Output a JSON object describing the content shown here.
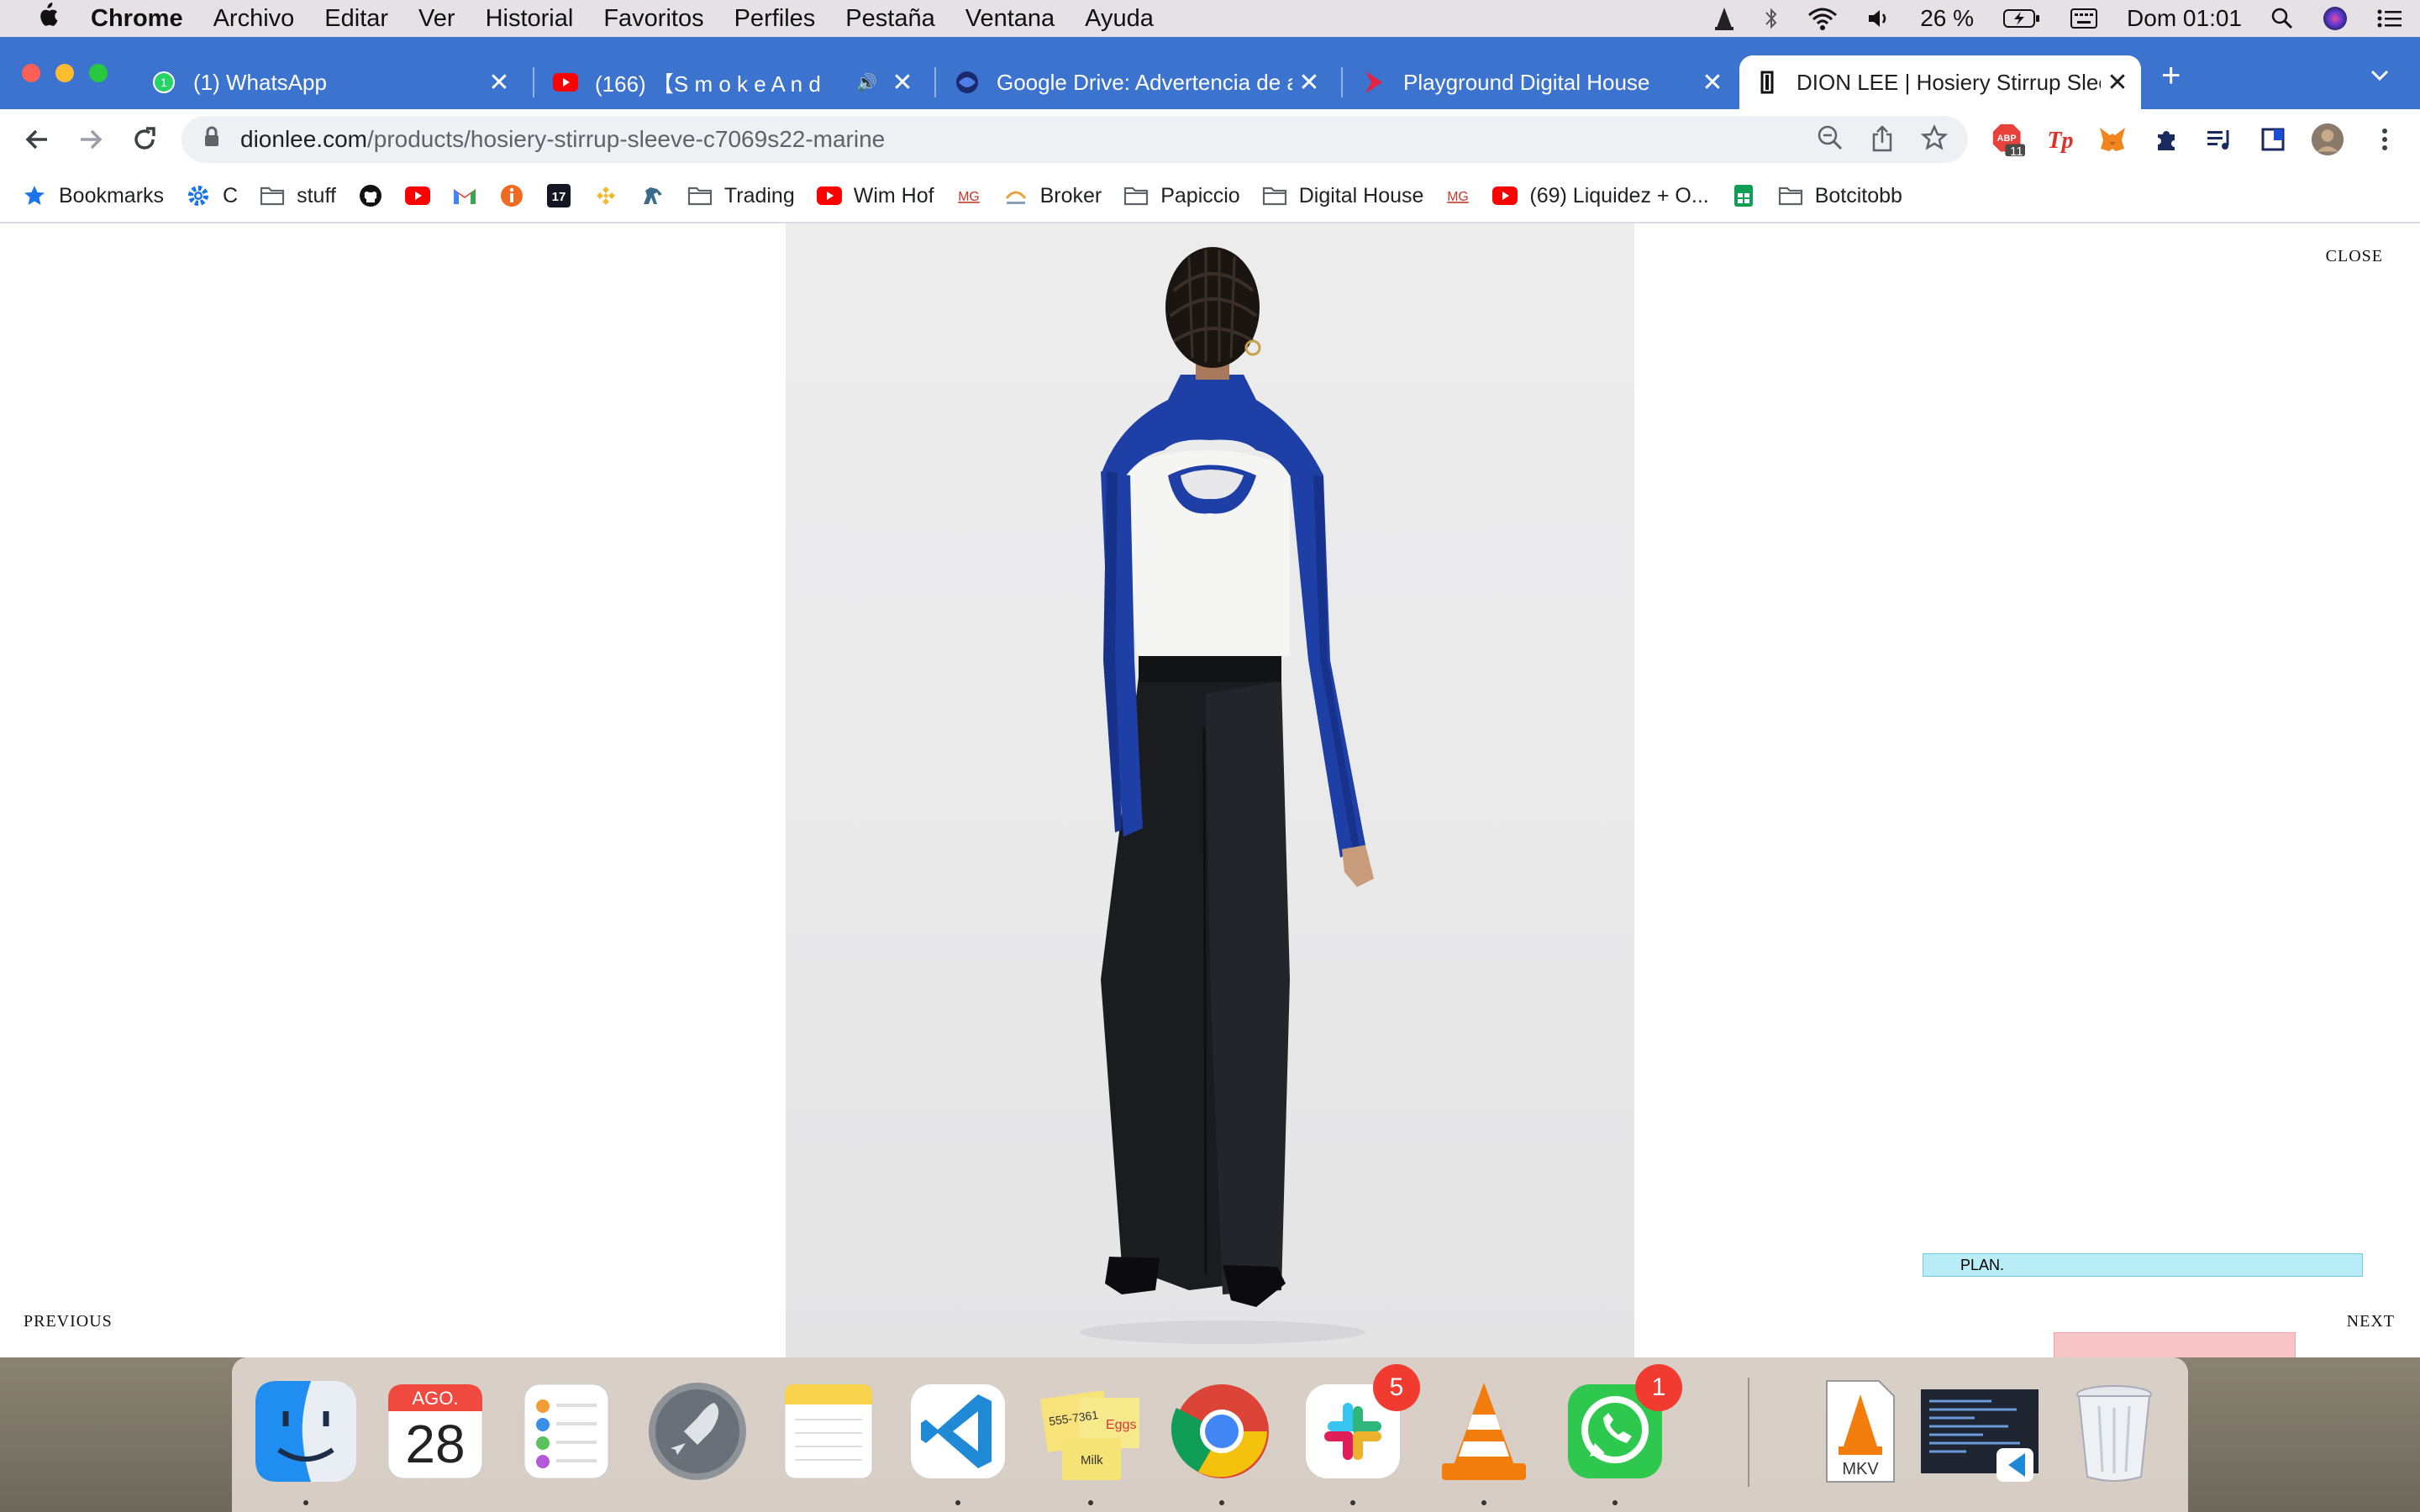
{
  "menubar": {
    "app": "Chrome",
    "items": [
      "Archivo",
      "Editar",
      "Ver",
      "Historial",
      "Favoritos",
      "Perfiles",
      "Pestaña",
      "Ventana",
      "Ayuda"
    ],
    "battery": "26 %",
    "clock": "Dom 01:01"
  },
  "tabs": [
    {
      "title": "(1) WhatsApp",
      "icon": "whatsapp-icon",
      "active": false
    },
    {
      "title": "(166) 【S m o k e   A n d",
      "icon": "youtube-icon",
      "active": false
    },
    {
      "title": "Google Drive: Advertencia de a",
      "icon": "drive-icon",
      "active": false
    },
    {
      "title": "Playground Digital House",
      "icon": "playground-icon",
      "active": false
    },
    {
      "title": "DION LEE | Hosiery Stirrup Slee",
      "icon": "dionlee-icon",
      "active": true
    }
  ],
  "omnibox": {
    "host": "dionlee.com",
    "path": "/products/hosiery-stirrup-sleeve-c7069s22-marine"
  },
  "bookmarks": [
    {
      "label": "Bookmarks",
      "icon": "star-icon"
    },
    {
      "label": "C",
      "icon": "gear-icon"
    },
    {
      "label": "stuff",
      "icon": "folder-icon"
    },
    {
      "label": "",
      "icon": "github-icon"
    },
    {
      "label": "",
      "icon": "youtube-icon"
    },
    {
      "label": "",
      "icon": "gmail-icon"
    },
    {
      "label": "",
      "icon": "info-icon"
    },
    {
      "label": "",
      "icon": "tradingview-icon"
    },
    {
      "label": "",
      "icon": "binance-icon"
    },
    {
      "label": "",
      "icon": "horse-icon"
    },
    {
      "label": "Trading",
      "icon": "folder-icon"
    },
    {
      "label": "Wim Hof",
      "icon": "youtube-icon"
    },
    {
      "label": "",
      "icon": "mg-icon"
    },
    {
      "label": "Broker",
      "icon": "alpari-icon"
    },
    {
      "label": "Papiccio",
      "icon": "folder-icon"
    },
    {
      "label": "Digital House",
      "icon": "folder-icon"
    },
    {
      "label": "",
      "icon": "mg-icon"
    },
    {
      "label": "(69) Liquidez + O...",
      "icon": "youtube-icon"
    },
    {
      "label": "",
      "icon": "sheets-icon"
    },
    {
      "label": "Botcitobb",
      "icon": "folder-icon"
    }
  ],
  "extensions": {
    "abp_count": "11"
  },
  "lightbox": {
    "close": "CLOSE",
    "previous": "PREVIOUS",
    "next": "NEXT"
  },
  "overlay": {
    "plan": "PLAN."
  },
  "dock": {
    "calendar_month": "AGO.",
    "calendar_day": "28",
    "stickies_line1": "555-7361",
    "stickies_line2": "Eggs",
    "stickies_line3": "Milk",
    "slack_badge": "5",
    "whatsapp_badge": "1",
    "mkv_label": "MKV"
  },
  "colors": {
    "tabstrip": "#3b73cf",
    "sleeve_blue": "#1d3fa6",
    "badge_red": "#f23b30"
  }
}
